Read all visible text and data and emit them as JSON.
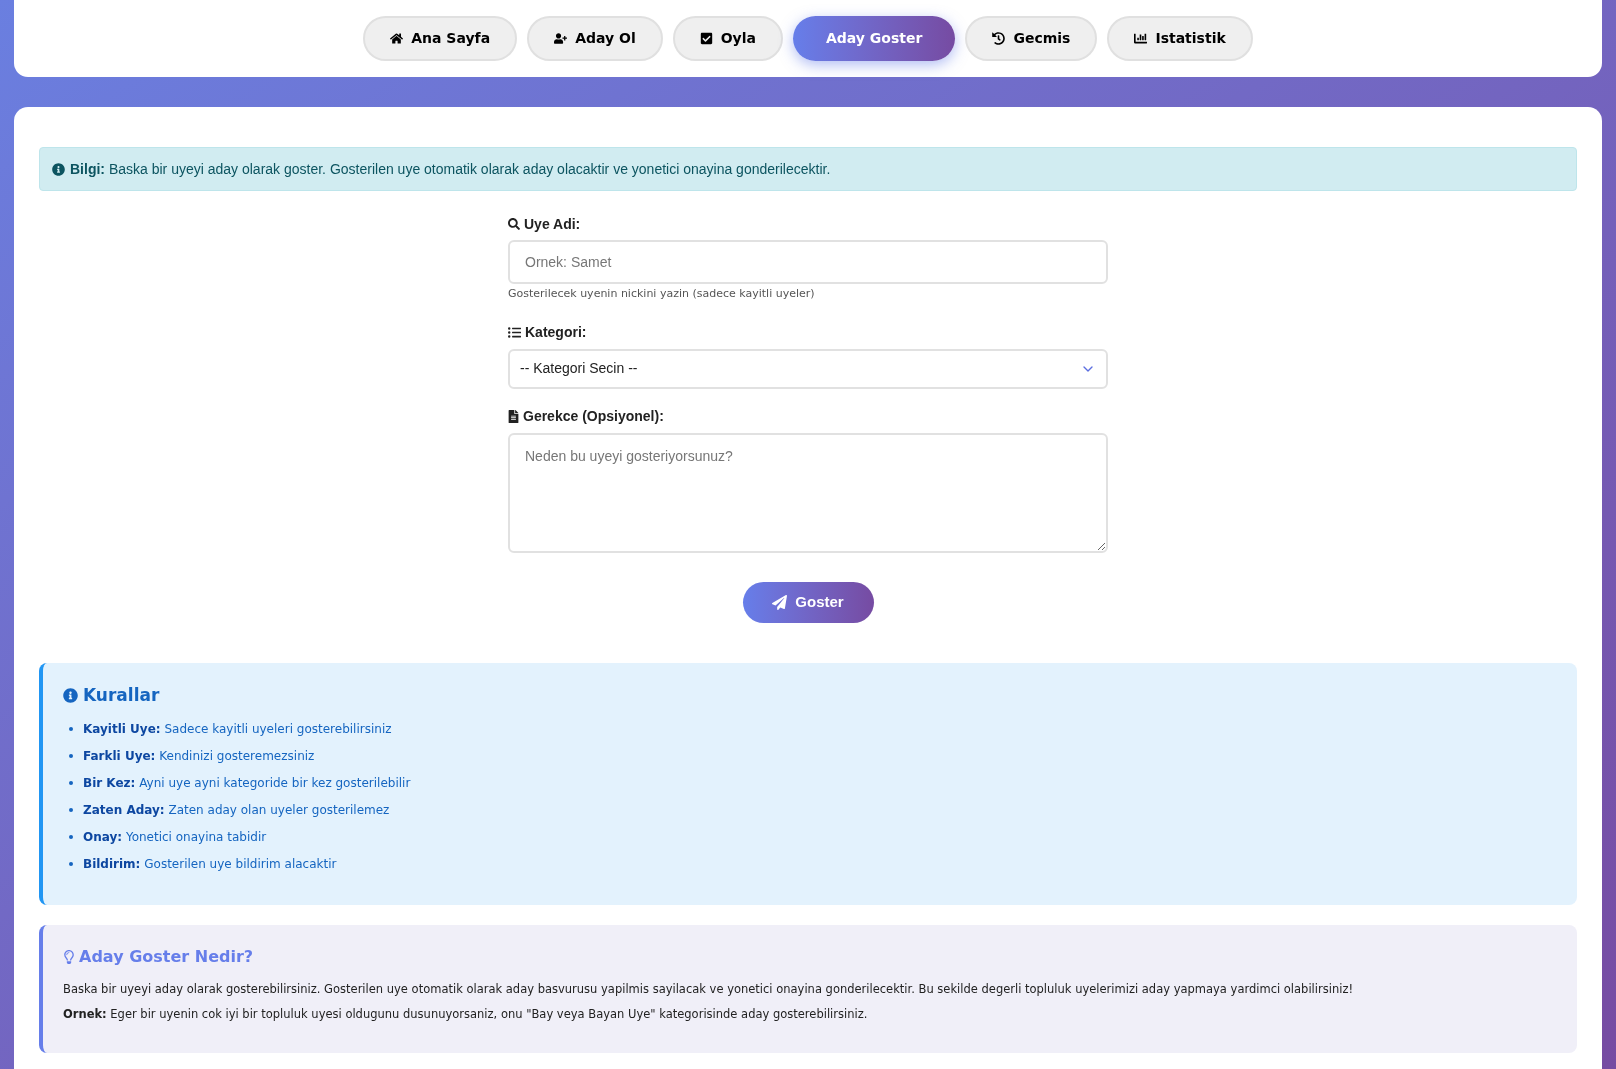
{
  "tabs": [
    {
      "label": "Ana Sayfa",
      "selected": false
    },
    {
      "label": "Aday Ol",
      "selected": false
    },
    {
      "label": "Oyla",
      "selected": false
    },
    {
      "label": "Aday Goster",
      "selected": true
    },
    {
      "label": "Gecmis",
      "selected": false
    },
    {
      "label": "Istatistik",
      "selected": false
    }
  ],
  "info_alert": "**Bilgi:** Baska bir uyeyi aday olarak goster. Gosterilen uye otomatik olarak aday olacaktir ve yonetici onayina gonderilecektir.",
  "form": {
    "member_label": "Uye Adi:",
    "member_placeholder": "Ornek: Samet",
    "member_help": "Gosterilecek uyenin nickini yazin (sadece kayitli uyeler)",
    "category_label": "Kategori:",
    "category_value": "-- Kategori Secin --",
    "reason_label": "Gerekce (Opsiyonel):",
    "reason_placeholder": "Neden bu uyeyi gosteriyorsunuz?",
    "submit": "Goster"
  },
  "rules": {
    "title": "Kurallar",
    "items": [
      "**Kayitli Uye:** Sadece kayitli uyeleri gosterebilirsiniz",
      "**Farkli Uye:** Kendinizi gosteremezsiniz",
      "**Bir Kez:** Ayni uye ayni kategoride bir kez gosterilebilir",
      "**Zaten Aday:** Zaten aday olan uyeler gosterilemez",
      "**Onay:** Yonetici onayina tabidir",
      "**Bildirim:** Gosterilen uye bildirim alacaktir"
    ]
  },
  "about": {
    "title": "Aday Goster Nedir?",
    "paragraphs": [
      "Baska bir uyeyi aday olarak gosterebilirsiniz. Gosterilen uye otomatik olarak aday basvurusu yapilmis sayilacak ve yonetici onayina gonderilecektir. Bu sekilde degerli topluluk uyelerimizi aday yapmaya yardimci olabilirsiniz!",
      "**Ornek:** Eger bir uyenin cok iyi bir topluluk uyesi oldugunu dusunuyorsaniz, onu \"Bay veya Bayan Uye\" kategorisinde aday gosterebilirsiniz."
    ]
  }
}
